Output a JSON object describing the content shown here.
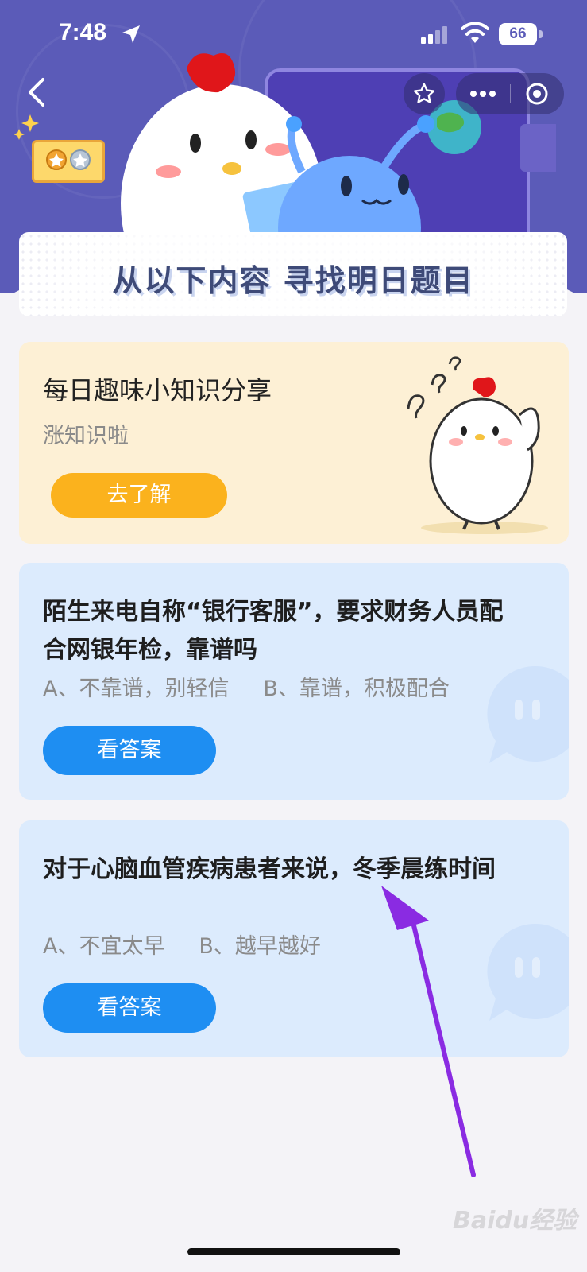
{
  "status_bar": {
    "time": "7:48",
    "battery": "66"
  },
  "banner": {
    "title": "从以下内容  寻找明日题目"
  },
  "fun_card": {
    "title": "每日趣味小知识分享",
    "subtitle": "涨知识啦",
    "button": "去了解"
  },
  "questions": [
    {
      "title": "陌生来电自称“银行客服”，要求财务人员配合网银年检，靠谱吗",
      "options": "A、不靠谱，别轻信     B、靠谱，积极配合",
      "button": "看答案"
    },
    {
      "title": "对于心脑血管疾病患者来说，冬季晨练时间",
      "options": "A、不宜太早     B、越早越好",
      "button": "看答案"
    }
  ],
  "watermark": "Baidu经验",
  "colors": {
    "header": "#5b5bb8",
    "fun_card_bg": "#fdf0d5",
    "question_card_bg": "#dcebfd",
    "orange_button": "#fbb21d",
    "blue_button": "#1e8ef2",
    "arrow": "#8a2be2"
  },
  "icons": [
    "location-arrow-icon",
    "signal-icon",
    "wifi-icon",
    "back-icon",
    "star-icon",
    "more-icon",
    "target-icon"
  ]
}
